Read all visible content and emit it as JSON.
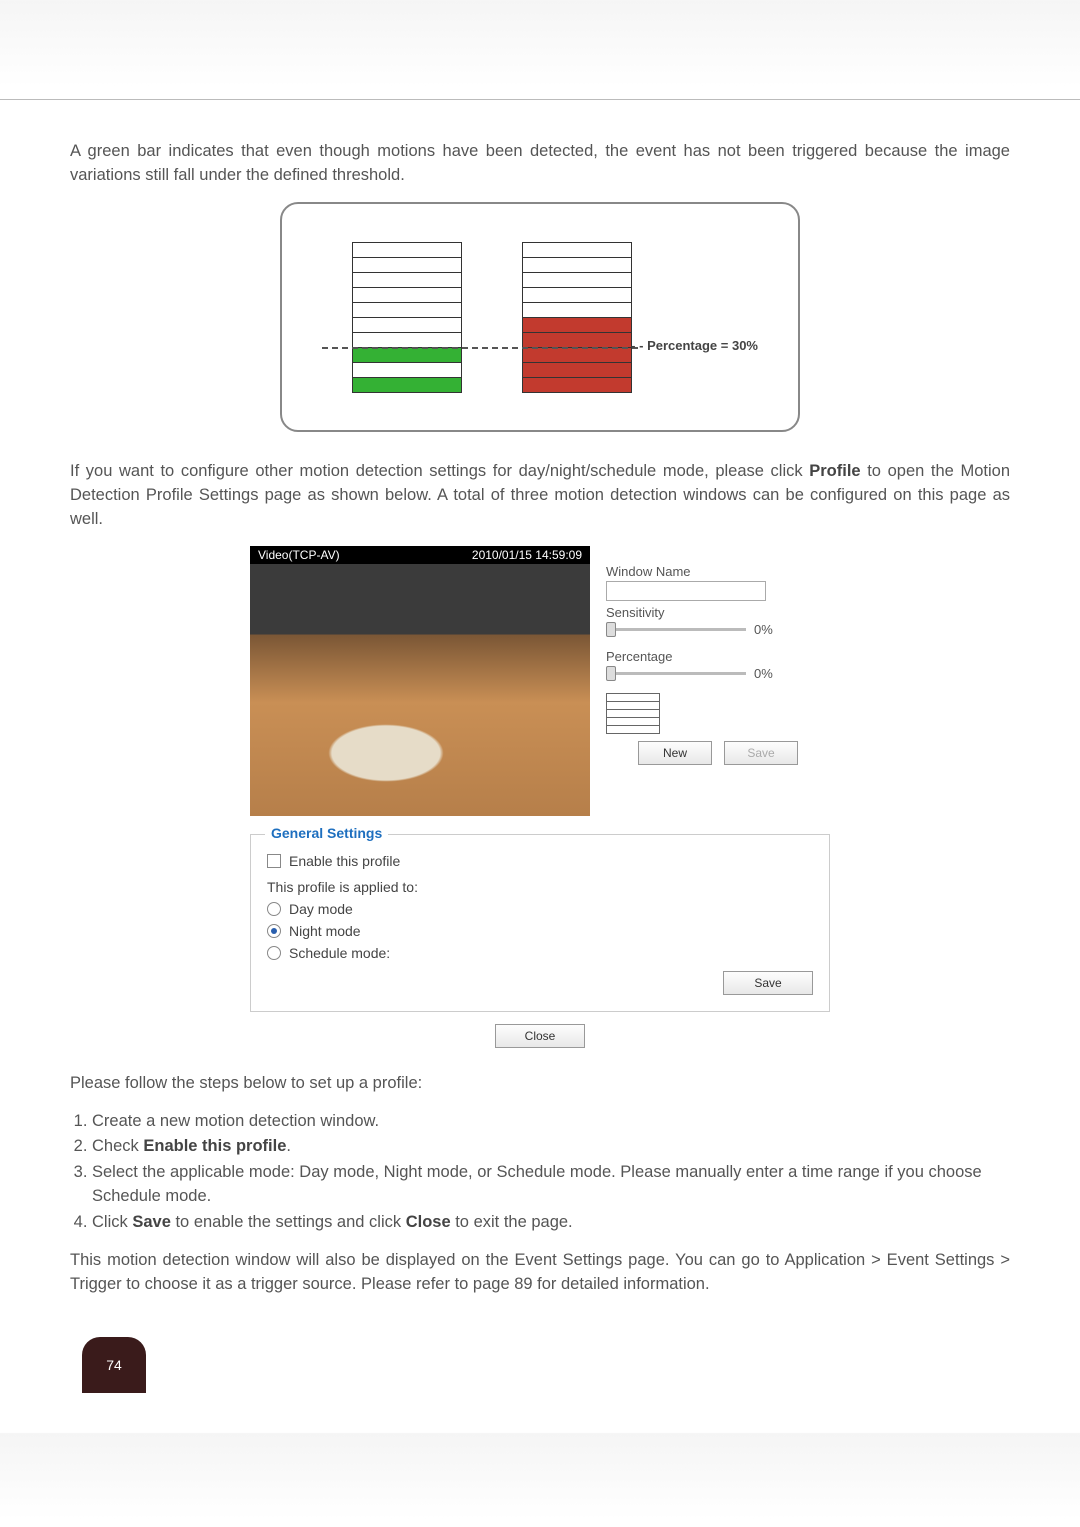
{
  "text": {
    "para1": "A green bar indicates that even though motions have been detected, the event has not been triggered because the image variations still fall under the defined threshold.",
    "pct_label": "Percentage = 30%",
    "para2_a": "If you want to configure other motion detection settings for day/night/schedule mode, please click ",
    "para2_b": "Profile",
    "para2_c": " to open the Motion Detection Profile Settings page as shown below. A total of three motion detection windows can be configured on this page as well.",
    "steps_intro": "Please follow the steps below to set up a profile:",
    "step1": "Create a new motion detection window.",
    "step2_a": "Check ",
    "step2_b": "Enable this profile",
    "step2_c": ".",
    "step3": "Select the applicable mode: Day mode, Night mode, or Schedule mode. Please manually enter a time range if you choose Schedule mode.",
    "step4_a": "Click ",
    "step4_b": "Save",
    "step4_c": " to enable the settings and click ",
    "step4_d": "Close",
    "step4_e": " to exit the page.",
    "para3": "This motion detection window will also be displayed on the Event Settings page. You can go to Application > Event Settings > Trigger to choose it as a trigger source. Please refer to page 89 for detailed information."
  },
  "video": {
    "title": "Video(TCP-AV)",
    "timestamp": "2010/01/15 14:59:09"
  },
  "panel": {
    "window_name_label": "Window Name",
    "window_name_value": "",
    "sensitivity_label": "Sensitivity",
    "sensitivity_value": "0%",
    "percentage_label": "Percentage",
    "percentage_value": "0%",
    "new_btn": "New",
    "save_btn": "Save"
  },
  "general": {
    "legend": "General Settings",
    "enable_label": "Enable this profile",
    "applied_label": "This profile is applied to:",
    "day": "Day mode",
    "night": "Night mode",
    "schedule": "Schedule mode:",
    "save": "Save",
    "close": "Close"
  },
  "page_number": "74"
}
